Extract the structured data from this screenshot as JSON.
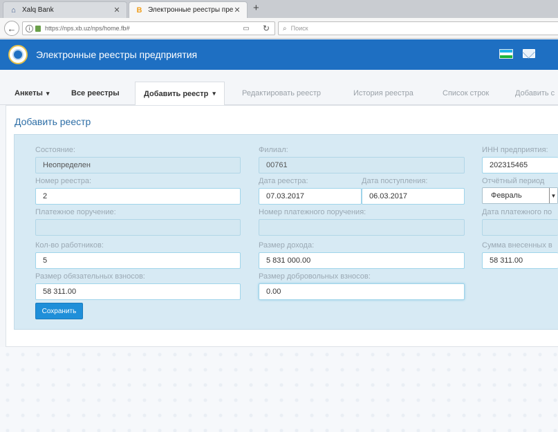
{
  "browser": {
    "tabs": [
      {
        "title": "Xalq Bank",
        "favicon": "bank-icon",
        "active": false
      },
      {
        "title": "Электронные реестры пред",
        "favicon": "b-icon",
        "active": true
      }
    ],
    "new_tab": "+",
    "url": "https://nps.xb.uz/nps/home.fb#",
    "search_placeholder": "Поиск",
    "back_icon": "arrow-left-icon",
    "reload_icon": "reload-icon"
  },
  "app": {
    "title": "Электронные реестры предприятия",
    "brand_color": "#1e6fc2",
    "flag_colors": [
      "#1eb3e6",
      "#ffffff",
      "#1eb53a"
    ]
  },
  "nav": {
    "tabs": [
      {
        "label": "Анкеты",
        "has_dropdown": true
      },
      {
        "label": "Все реестры",
        "has_dropdown": false
      },
      {
        "label": "Добавить реестр",
        "has_dropdown": true,
        "selected": true
      },
      {
        "label": "Редактировать реестр"
      },
      {
        "label": "История реестра"
      },
      {
        "label": "Список строк"
      },
      {
        "label": "Добавить с"
      }
    ],
    "caret": "▾"
  },
  "page": {
    "title": "Добавить реестр"
  },
  "form": {
    "state_label": "Состояние:",
    "state_value": "Неопределен",
    "branch_label": "Филиал:",
    "branch_value": "00761",
    "inn_label": "ИНН предприятия:",
    "inn_value": "202315465",
    "reg_no_label": "Номер реестра:",
    "reg_no_value": "2",
    "reg_date_label": "Дата реестра:",
    "reg_date_value": "07.03.2017",
    "receipt_date_label": "Дата поступления:",
    "receipt_date_value": "06.03.2017",
    "period_label": "Отчётный период",
    "period_value": "Февраль",
    "payment_order_label": "Платежное поручение:",
    "payment_order_value": "",
    "payment_order_no_label": "Номер платежного поручения:",
    "payment_order_no_value": "",
    "payment_date_label": "Дата платежного по",
    "payment_date_value": "",
    "employees_label": "Кол-во работников:",
    "employees_value": "5",
    "income_label": "Размер дохода:",
    "income_value": "5 831 000.00",
    "paid_sum_label": "Сумма внесенных в",
    "paid_sum_value": "58 311.00",
    "mandatory_label": "Размер обязательных взносов:",
    "mandatory_value": "58 311.00",
    "voluntary_label": "Размер добровольных взносов:",
    "voluntary_value": "0.00",
    "save_label": "Сохранить"
  }
}
